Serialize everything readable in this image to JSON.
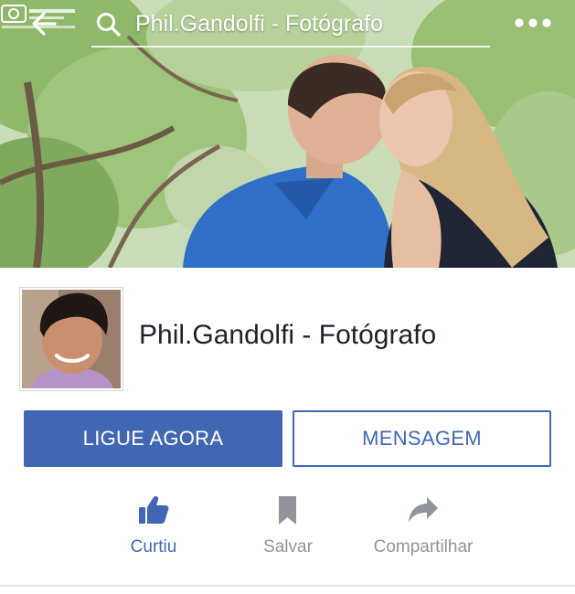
{
  "header": {
    "search_query": "Phil.Gandolfi - Fotógrafo"
  },
  "page": {
    "name": "Phil.Gandolfi - Fotógrafo"
  },
  "buttons": {
    "call_label": "LIGUE AGORA",
    "message_label": "MENSAGEM"
  },
  "actions": {
    "like_label": "Curtiu",
    "save_label": "Salvar",
    "share_label": "Compartilhar"
  },
  "colors": {
    "brand_blue": "#4267b2",
    "muted_gray": "#90949c"
  },
  "icons": [
    "back-arrow-icon",
    "search-icon",
    "more-dots-icon",
    "thumbs-up-icon",
    "bookmark-icon",
    "share-arrow-icon"
  ]
}
